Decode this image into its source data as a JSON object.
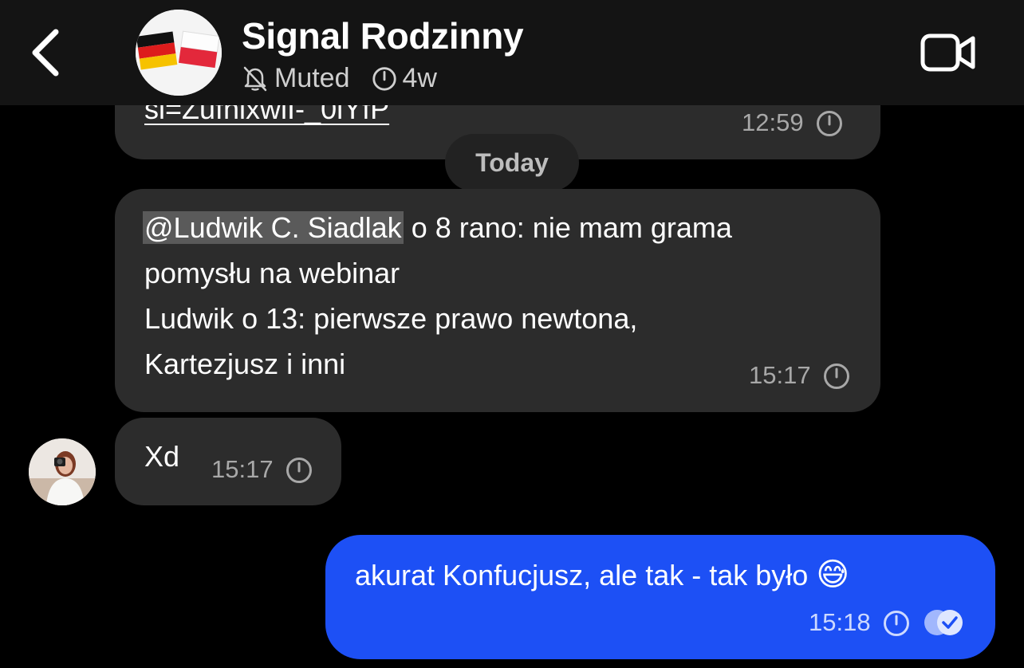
{
  "header": {
    "title": "Signal Rodzinny",
    "muted_label": "Muted",
    "timer_label": "4w"
  },
  "messages": {
    "prev": {
      "link_fragment": "si=ZufnixwlI-_0lYfP",
      "time": "12:59"
    },
    "date_divider": "Today",
    "msg1": {
      "mention": "@Ludwik C. Siadlak",
      "line1_rest": " o 8 rano: nie mam grama",
      "line2": "pomysłu na webinar",
      "line3": "Ludwik o 13: pierwsze prawo newtona,",
      "line4": "Kartezjusz i inni",
      "time": "15:17"
    },
    "msg2": {
      "text": "Xd",
      "time": "15:17"
    },
    "outgoing": {
      "text": "akurat Konfucjusz, ale tak - tak było",
      "emoji": "😅",
      "time": "15:18"
    }
  },
  "icons": {
    "back": "chevron-left-icon",
    "muted": "bell-slash-icon",
    "timer": "timer-icon",
    "video": "video-camera-icon",
    "expire": "disappearing-timer-icon",
    "read": "read-receipt-icon"
  },
  "colors": {
    "background": "#000000",
    "header": "#141414",
    "incoming_bubble": "#2c2c2c",
    "outgoing_bubble": "#1d50f5"
  }
}
